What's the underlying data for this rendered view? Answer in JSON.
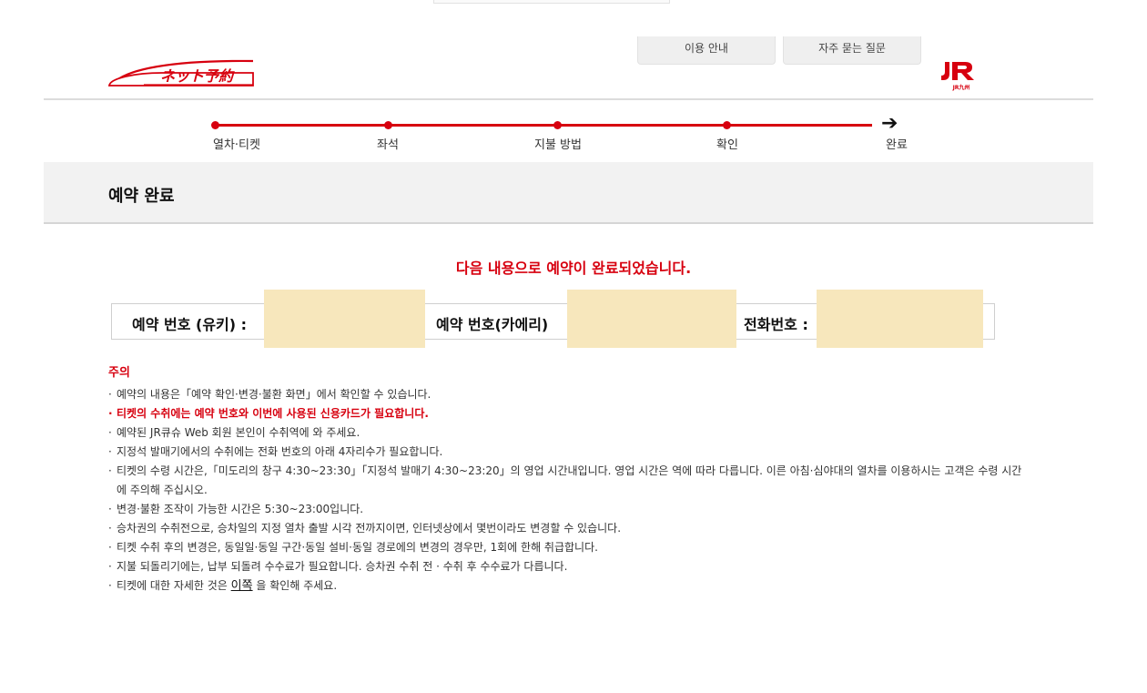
{
  "header": {
    "nav_guide": "이용 안내",
    "nav_faq": "자주 묻는 질문"
  },
  "steps": [
    "열차·티켓",
    "좌석",
    "지불 방법",
    "확인",
    "완료"
  ],
  "page_title": "예약 완료",
  "completion_message": "다음 내용으로 예약이 완료되었습니다.",
  "reservation": {
    "label_up": "예약 번호 (유키) :",
    "label_down": "예약 번호(카에리)",
    "label_phone": "전화번호 :"
  },
  "notes": {
    "title": "주의",
    "items": [
      "예약의 내용은「예약 확인·변경·불환 화면」에서 확인할 수 있습니다.",
      "티켓의 수취에는 예약 번호와 이번에 사용된 신용카드가 필요합니다.",
      "예약된 JR큐슈 Web 회원 본인이 수취역에 와 주세요.",
      "지정석 발매기에서의 수취에는 전화 번호의 아래 4자리수가 필요합니다.",
      "티켓의 수령 시간은,「미도리의 창구 4:30~23:30」「지정석 발매기 4:30~23:20」의 영업 시간내입니다. 영업 시간은 역에 따라 다릅니다. 이른 아침·심야대의 열차를 이용하시는 고객은 수령 시간에 주의해 주십시오.",
      "변경·불환 조작이 가능한 시간은 5:30~23:00입니다.",
      "승차권의 수취전으로, 승차일의 지정 열차 출발 시각 전까지이면, 인터넷상에서 몇번이라도 변경할 수 있습니다.",
      "티켓 수취 후의 변경은, 동일일·동일 구간·동일 설비·동일 경로에의 변경의 경우만, 1회에 한해 취급합니다.",
      "지불 되돌리기에는, 납부 되돌려 수수료가 필요합니다. 승차권 수취 전 · 수취 후 수수료가 다릅니다."
    ],
    "last_prefix": "티켓에 대한 자세한 것은 ",
    "last_link": "이쪽",
    "last_suffix": " 을 확인해 주세요."
  },
  "colors": {
    "accent_red": "#d7000f",
    "masked_value": "#f7e7bc",
    "band_gray": "#f2f2f2"
  },
  "icons": {
    "brand_logo": "net-yoyaku-logo",
    "company_logo": "jr-kyushu-logo",
    "step_final": "arrow-right-icon"
  }
}
